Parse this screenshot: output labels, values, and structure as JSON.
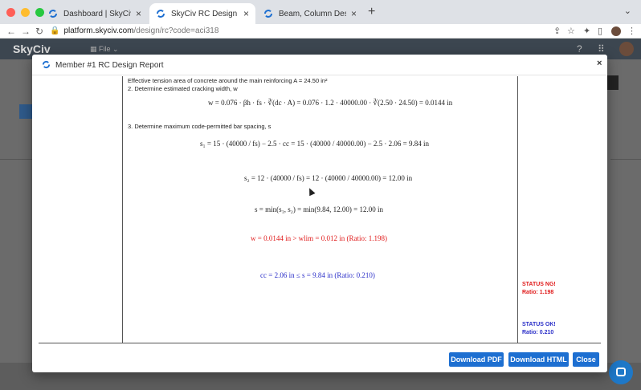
{
  "browser": {
    "tabs": [
      {
        "title": "Dashboard | SkyCiv Platform"
      },
      {
        "title": "SkyCiv RC Design | SkyCiv Pla"
      },
      {
        "title": "Beam, Column Design – Standa"
      }
    ],
    "url_host": "platform.skyciv.com",
    "url_path": "/design/rc?code=aci318"
  },
  "app": {
    "logo": "SkyCiv",
    "file_menu": "File"
  },
  "modal": {
    "title": "Member #1 RC Design Report",
    "report": {
      "line_tension_area": "Effective tension area of concrete around the main reinforcing A = 24.50 in²",
      "step2": "2. Determine estimated cracking width, w",
      "eq_w": "w = 0.076 · βh · fs · ∛(dc · A) = 0.076 · 1.2 · 40000.00 · ∛(2.50 · 24.50) = 0.0144 in",
      "step3": "3. Determine maximum code-permitted bar spacing, s",
      "eq_s1": "s₁ = 15 · (40000 / fs) − 2.5 · cc = 15 · (40000 / 40000.00) − 2.5 · 2.06 = 9.84 in",
      "eq_s2": "s₂ = 12 · (40000 / fs) = 12 · (40000 / 40000.00) = 12.00 in",
      "eq_s": "s = min(s₁, s₂) = min(9.84, 12.00) = 12.00 in",
      "check_w": "w = 0.0144 in > wlim = 0.012 in (Ratio: 1.198)",
      "check_cc": "cc = 2.06 in ≤ s = 9.84 in (Ratio: 0.210)"
    },
    "status_ng": {
      "label": "STATUS NG!",
      "ratio": "Ratio: 1.198"
    },
    "status_ok": {
      "label": "STATUS OK!",
      "ratio": "Ratio: 0.210"
    },
    "buttons": {
      "pdf": "Download PDF",
      "html": "Download HTML",
      "close": "Close"
    }
  },
  "colors": {
    "accent": "#1d6fd1",
    "fail": "#e01b1b",
    "pass": "#2a2ec8"
  }
}
